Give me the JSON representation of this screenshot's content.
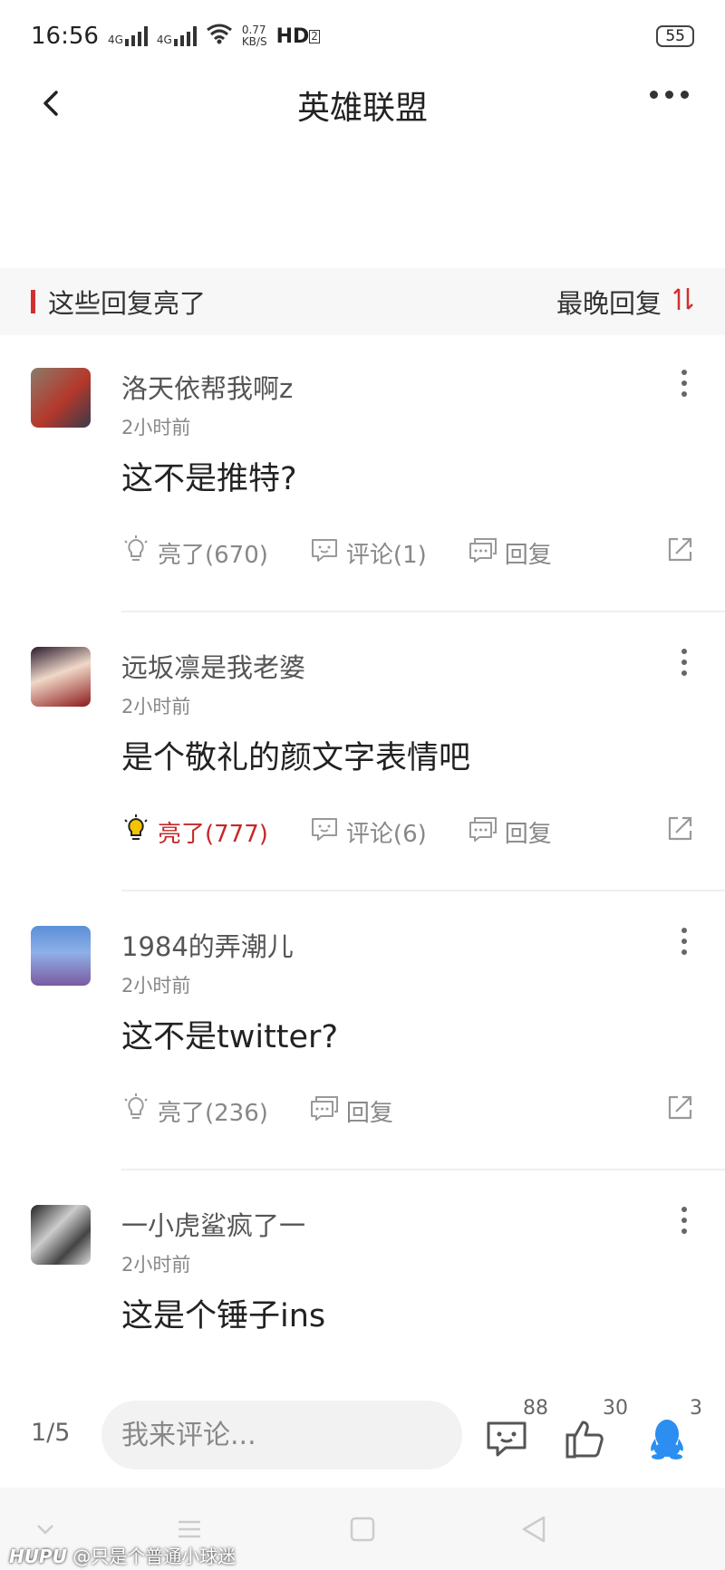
{
  "status_bar": {
    "time": "16:56",
    "network1": "4G",
    "network2": "4G",
    "speed": "0.77",
    "speed_unit": "KB/S",
    "hd": "HD",
    "hd_sub": "2",
    "battery": "55"
  },
  "header": {
    "title": "英雄联盟"
  },
  "section": {
    "title": "这些回复亮了",
    "sort_label": "最晚回复"
  },
  "comments": [
    {
      "username": "洛天依帮我啊z",
      "time": "2小时前",
      "content": "这不是推特?",
      "like_label": "亮了(670)",
      "comment_label": "评论(1)",
      "reply_label": "回复",
      "liked": false
    },
    {
      "username": "远坂凛是我老婆",
      "time": "2小时前",
      "content": "是个敬礼的颜文字表情吧",
      "like_label": "亮了(777)",
      "comment_label": "评论(6)",
      "reply_label": "回复",
      "liked": true
    },
    {
      "username": "1984的弄潮儿",
      "time": "2小时前",
      "content": "这不是twitter?",
      "like_label": "亮了(236)",
      "reply_label": "回复",
      "liked": false
    },
    {
      "username": "一小虎鲨疯了一",
      "time": "2小时前",
      "content": "这是个锤子ins"
    }
  ],
  "bottom_bar": {
    "page_indicator": "1/5",
    "input_placeholder": "我来评论...",
    "comment_count": "88",
    "like_count": "30",
    "share_count": "3"
  },
  "watermark": {
    "brand": "HUPU",
    "user": "@只是个普通小球迷"
  },
  "colors": {
    "accent": "#d32f2f",
    "qq_blue": "#2b8ef0"
  }
}
